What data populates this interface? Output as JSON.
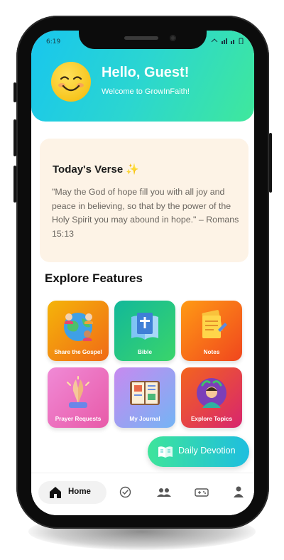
{
  "status_bar": {
    "time": "6:19",
    "icons": "wifi signal battery"
  },
  "header": {
    "greeting": "Hello, Guest!",
    "subtitle": "Welcome to GrowInFaith!",
    "avatar": "smiley-face-icon"
  },
  "verse": {
    "title": "Today's Verse ✨",
    "text": "\"May the God of hope fill you with all joy and peace in believing, so that by the power of the Holy Spirit you may abound in hope.\" – Romans 15:13"
  },
  "explore": {
    "title": "Explore Features",
    "features": [
      {
        "label": "Share the Gospel",
        "icon": "globe-people-icon",
        "color_from": "#f5b40a",
        "color_to": "#f06a16"
      },
      {
        "label": "Bible",
        "icon": "bible-book-icon",
        "color_from": "#12b89a",
        "color_to": "#3ad56a"
      },
      {
        "label": "Notes",
        "icon": "notes-icon",
        "color_from": "#ff9a14",
        "color_to": "#f0461e"
      },
      {
        "label": "Prayer Requests",
        "icon": "praying-hands-icon",
        "color_from": "#f08ad6",
        "color_to": "#e85aa8"
      },
      {
        "label": "My Journal",
        "icon": "journal-icon",
        "color_from": "#c78af0",
        "color_to": "#74b4f4"
      },
      {
        "label": "Explore Topics",
        "icon": "explore-person-icon",
        "color_from": "#f3641e",
        "color_to": "#d8256e"
      }
    ]
  },
  "fab": {
    "label": "Daily Devotion",
    "icon": "book-open-icon"
  },
  "bottom_nav": {
    "items": [
      {
        "label": "Home",
        "icon": "home-icon",
        "active": true
      },
      {
        "label": "",
        "icon": "check-circle-icon"
      },
      {
        "label": "",
        "icon": "group-icon"
      },
      {
        "label": "",
        "icon": "gamepad-icon"
      },
      {
        "label": "",
        "icon": "person-icon"
      }
    ]
  }
}
